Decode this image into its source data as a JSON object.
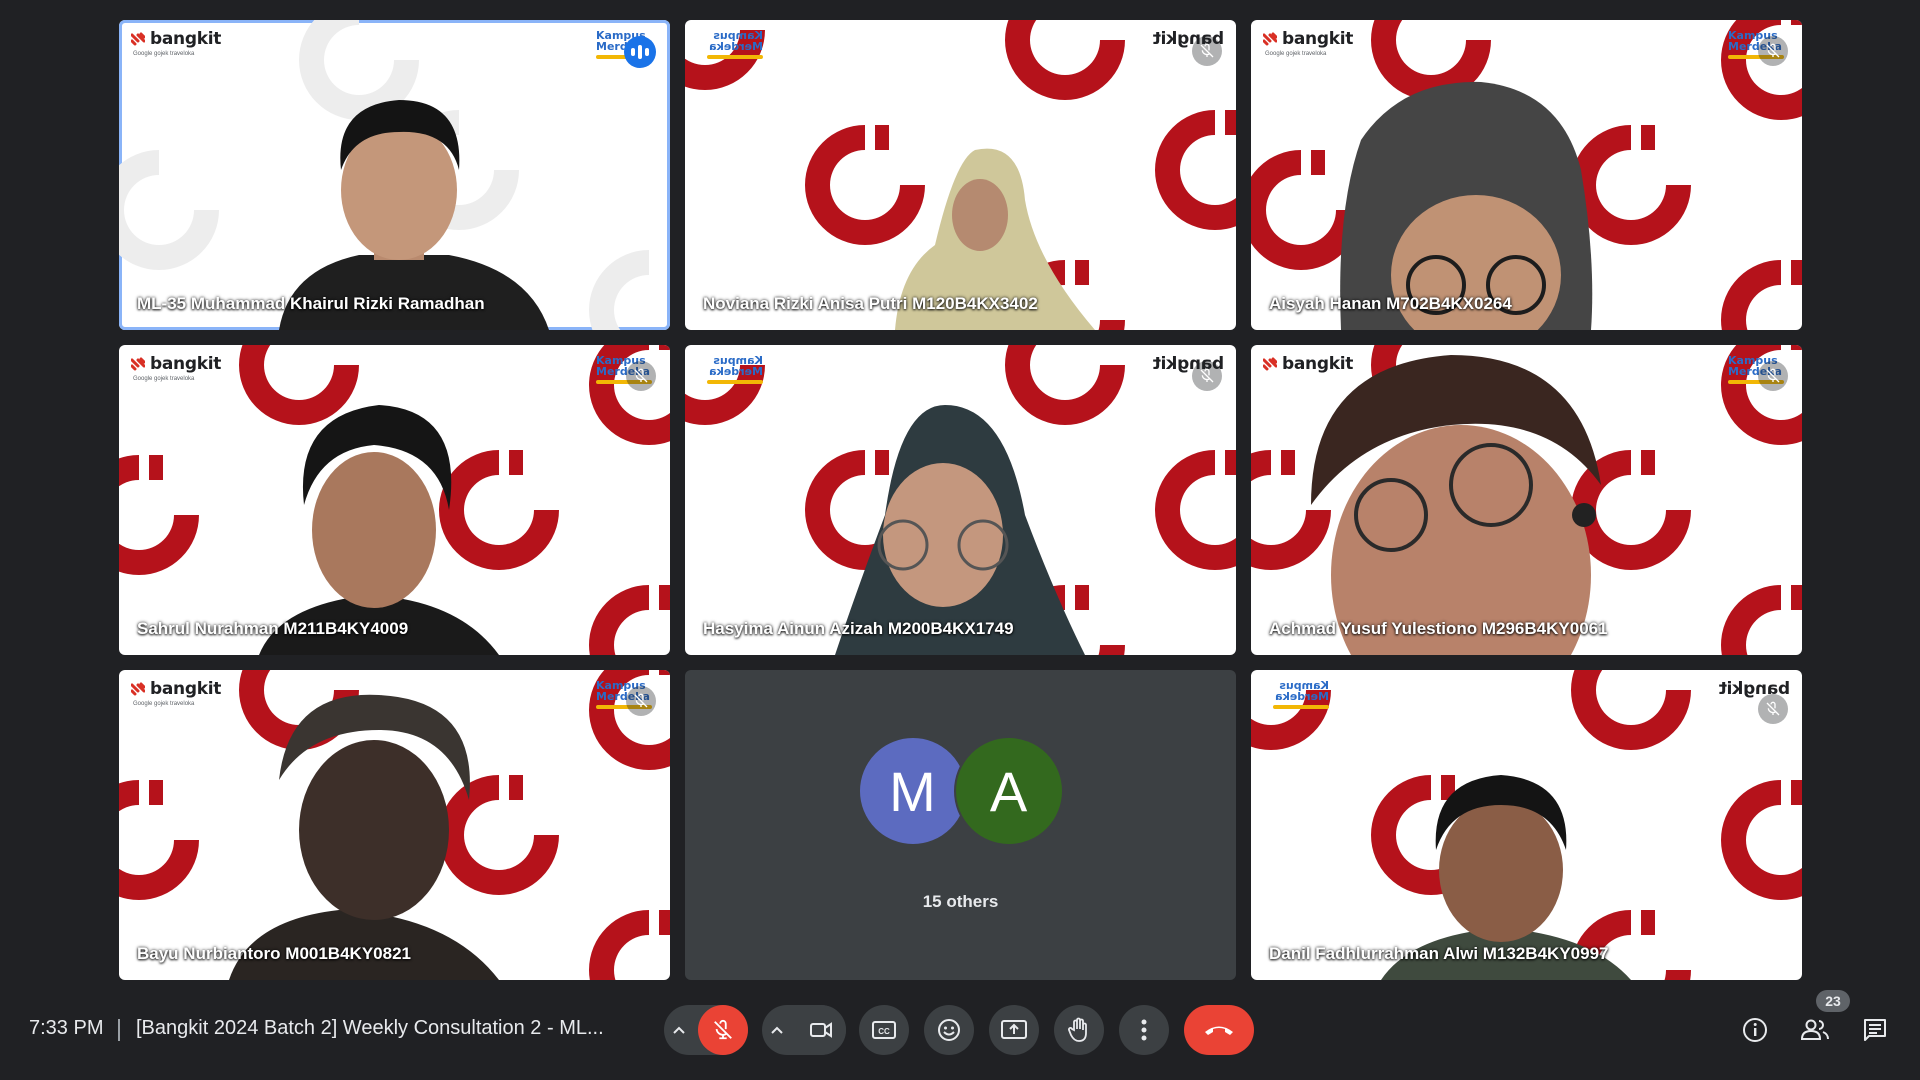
{
  "colors": {
    "background": "#202124",
    "accent": "#8ab4f8",
    "brand_red": "#b5121b",
    "end_call": "#ea4335"
  },
  "branding": {
    "bangkit": "bangkit",
    "sponsors": "Google  gojek  traveloka",
    "kampus_merdeka": "Kampus Merdeka"
  },
  "participants": [
    {
      "name": "ML-35 Muhammad Khairul Rizki Ramadhan",
      "status": "speaking"
    },
    {
      "name": "Noviana Rizki Anisa Putri M120B4KX3402",
      "status": "muted"
    },
    {
      "name": "Aisyah Hanan M702B4KX0264",
      "status": "muted"
    },
    {
      "name": "Sahrul Nurahman M211B4KY4009",
      "status": "muted"
    },
    {
      "name": "Hasyima Ainun Azizah M200B4KX1749",
      "status": "muted"
    },
    {
      "name": "Achmad Yusuf Yulestiono M296B4KY0061",
      "status": "muted"
    },
    {
      "name": "Bayu Nurbiantoro M001B4KY0821",
      "status": "muted"
    },
    {
      "name": "Danil Fadhlurrahman Alwi M132B4KY0997",
      "status": "muted"
    }
  ],
  "others": {
    "avatars": [
      {
        "letter": "M",
        "color": "#5c6bc0"
      },
      {
        "letter": "A",
        "color": "#33691e"
      }
    ],
    "label": "15 others"
  },
  "bottom_bar": {
    "time": "7:33 PM",
    "meeting_title": "[Bangkit 2024 Batch 2] Weekly Consultation 2 - ML...",
    "participant_count": "23",
    "icons": [
      "mic-off-icon",
      "camera-icon",
      "captions-icon",
      "emoji-icon",
      "present-icon",
      "raise-hand-icon",
      "more-options-icon",
      "end-call-icon",
      "info-icon",
      "people-icon",
      "chat-icon"
    ]
  }
}
